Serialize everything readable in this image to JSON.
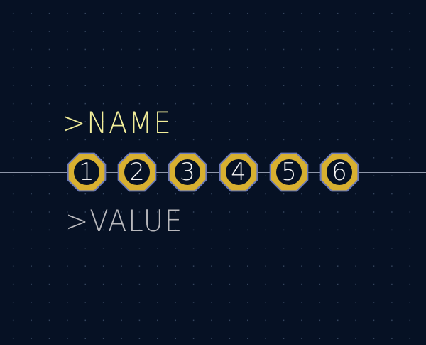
{
  "footprint": {
    "reference": ">NAME",
    "value": ">VALUE"
  },
  "pads": [
    {
      "number": "1"
    },
    {
      "number": "2"
    },
    {
      "number": "3"
    },
    {
      "number": "4"
    },
    {
      "number": "5"
    },
    {
      "number": "6"
    }
  ],
  "colors": {
    "background": "#061124",
    "grid_dot": "#3a4a66",
    "crosshair": "#8d95a8",
    "reference_text": "#f2ee9a",
    "value_text": "#b9b9bd",
    "pad_fill": "#d8b030",
    "pad_outline": "#6a78b8",
    "pad_hole": "#061124",
    "pad_number": "#f4f4f4"
  }
}
